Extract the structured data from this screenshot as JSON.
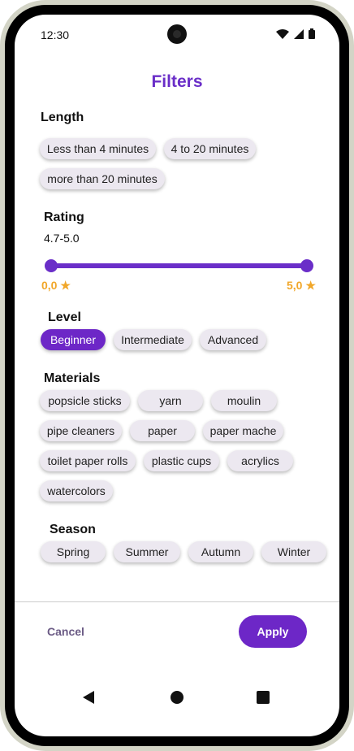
{
  "status": {
    "time": "12:30"
  },
  "title": "Filters",
  "length": {
    "label": "Length",
    "chips": [
      "Less than 4 minutes",
      "4 to 20 minutes",
      "more than 20 minutes"
    ]
  },
  "rating": {
    "label": "Rating",
    "range_text": "4.7-5.0",
    "min_label": "0,0",
    "max_label": "5,0",
    "min": 0.0,
    "max": 5.0,
    "selected_low": 0.0,
    "selected_high": 5.0,
    "star": "★"
  },
  "level": {
    "label": "Level",
    "chips": [
      "Beginner",
      "Intermediate",
      "Advanced"
    ],
    "selected": "Beginner"
  },
  "materials": {
    "label": "Materials",
    "chips": [
      "popsicle sticks",
      "yarn",
      "moulin",
      "pipe cleaners",
      "paper",
      "paper mache",
      "toilet paper rolls",
      "plastic cups",
      "acrylics",
      "watercolors"
    ]
  },
  "season": {
    "label": "Season",
    "chips": [
      "Spring",
      "Summer",
      "Autumn",
      "Winter"
    ]
  },
  "actions": {
    "cancel": "Cancel",
    "apply": "Apply"
  },
  "colors": {
    "accent": "#6a2ec8",
    "star": "#f1a72a",
    "chip_bg": "#ece8f0"
  },
  "icons": [
    "wifi-icon",
    "signal-icon",
    "battery-icon",
    "star-icon",
    "back-icon",
    "home-icon",
    "recents-icon"
  ]
}
